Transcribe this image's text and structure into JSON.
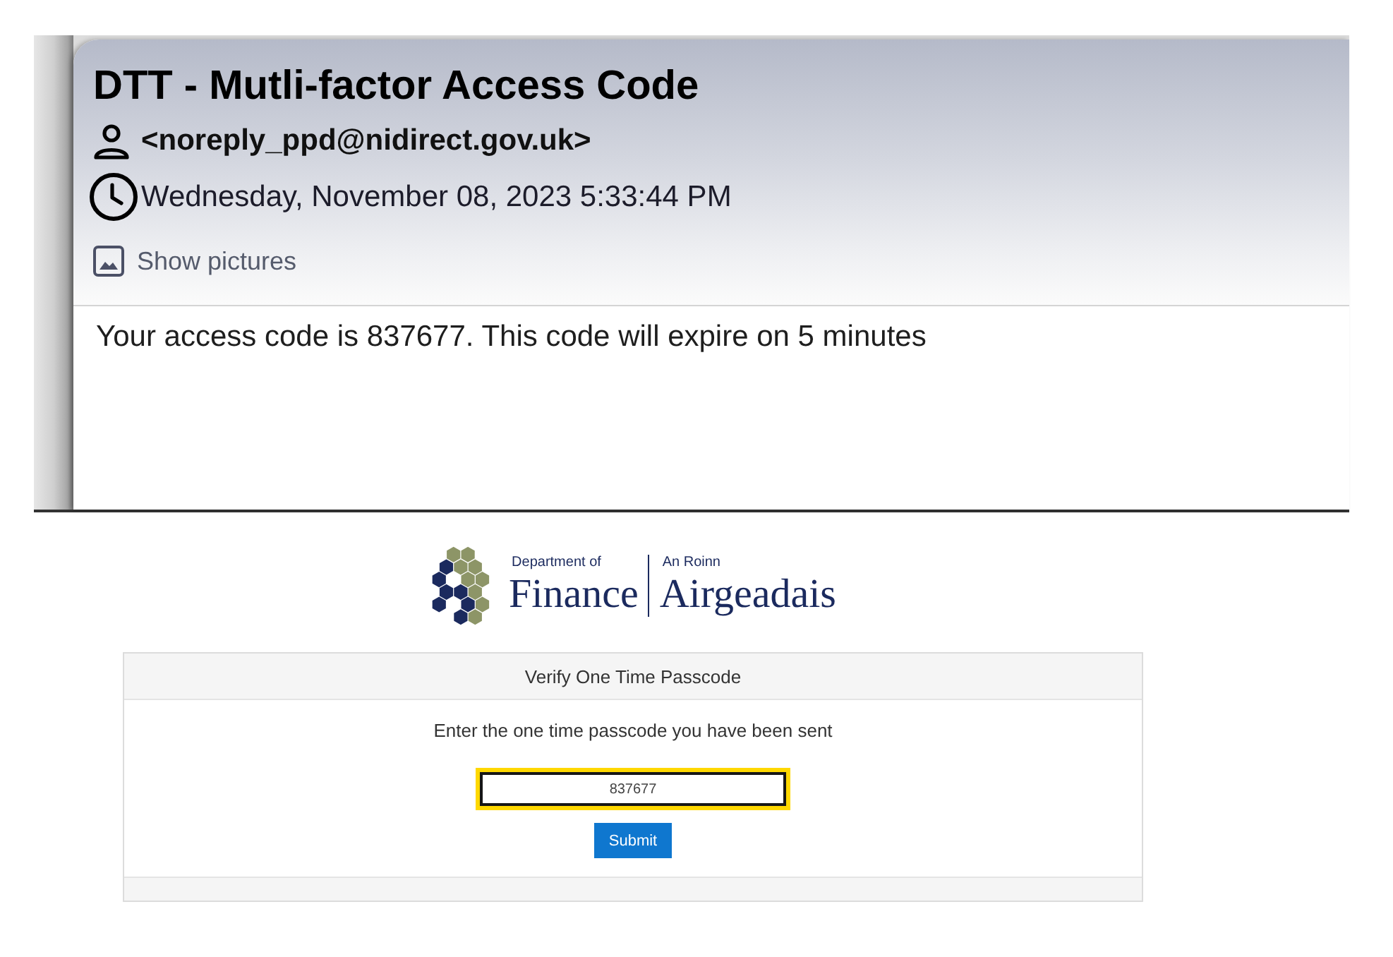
{
  "email": {
    "subject": "DTT - Mutli-factor Access Code",
    "sender": "<noreply_ppd@nidirect.gov.uk>",
    "date": "Wednesday, November 08, 2023 5:33:44 PM",
    "show_pictures": "Show pictures",
    "body": "Your access code is 837677. This code will expire on 5 minutes"
  },
  "logo": {
    "department_label": "Department of",
    "department_name": "Finance",
    "irish_label": "An Roinn",
    "irish_name": "Airgeadais"
  },
  "card": {
    "title": "Verify One Time Passcode",
    "instruction": "Enter the one time passcode you have been sent",
    "passcode_field": {
      "value": "837677",
      "focused": true
    },
    "submit_button": "Submit"
  }
}
